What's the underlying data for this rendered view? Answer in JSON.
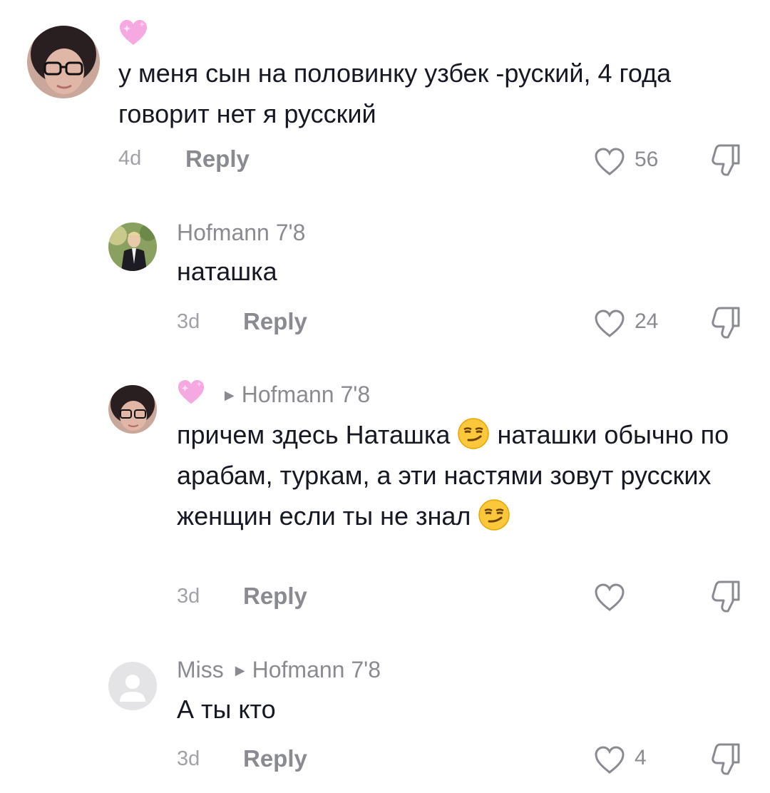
{
  "comments": [
    {
      "username": "",
      "reply_to": "",
      "text": "у меня сын на половинку узбек -руский, 4 года говорит нет я русский",
      "age": "4d",
      "reply_label": "Reply",
      "likes": "56"
    },
    {
      "username": "Hofmann 7'8",
      "reply_to": "",
      "text": "наташка",
      "age": "3d",
      "reply_label": "Reply",
      "likes": "24"
    },
    {
      "username": "",
      "reply_to": "Hofmann 7'8",
      "text_parts": [
        "причем здесь Наташка ",
        " наташки обычно по арабам, туркам, а эти настями зовут русских женщин если ты не знал "
      ],
      "age": "3d",
      "reply_label": "Reply",
      "likes": ""
    },
    {
      "username": "Miss",
      "reply_to": "Hofmann 7'8",
      "text": "А ты кто",
      "age": "3d",
      "reply_label": "Reply",
      "likes": "4"
    }
  ],
  "icons": {
    "heart": "heart-outline-icon",
    "dislike": "thumbs-down-icon",
    "badge": "pink-heart-icon",
    "emoji": "smirking-face-emoji"
  },
  "colors": {
    "text": "#161823",
    "secondary": "#8a8b91",
    "timestamp": "#a1a2a7"
  }
}
